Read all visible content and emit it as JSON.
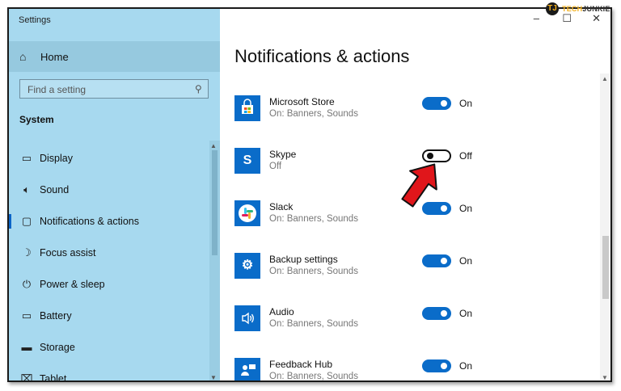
{
  "window": {
    "title": "Settings",
    "minimize": "–",
    "maximize": "☐",
    "close": "✕"
  },
  "sidebar": {
    "home_label": "Home",
    "search_placeholder": "Find a setting",
    "section_title": "System",
    "items": [
      {
        "label": "Display",
        "icon": "monitor-icon"
      },
      {
        "label": "Sound",
        "icon": "speaker-icon"
      },
      {
        "label": "Notifications & actions",
        "icon": "message-icon",
        "active": true
      },
      {
        "label": "Focus assist",
        "icon": "moon-icon"
      },
      {
        "label": "Power & sleep",
        "icon": "power-icon"
      },
      {
        "label": "Battery",
        "icon": "battery-icon"
      },
      {
        "label": "Storage",
        "icon": "drive-icon"
      },
      {
        "label": "Tablet",
        "icon": "tablet-icon"
      }
    ]
  },
  "main": {
    "title": "Notifications & actions",
    "apps": [
      {
        "name": "Microsoft Store",
        "desc": "On: Banners, Sounds",
        "state": "On",
        "on": true,
        "icon": "store-icon"
      },
      {
        "name": "Skype",
        "desc": "Off",
        "state": "Off",
        "on": false,
        "icon": "skype-icon"
      },
      {
        "name": "Slack",
        "desc": "On: Banners, Sounds",
        "state": "On",
        "on": true,
        "icon": "slack-icon"
      },
      {
        "name": "Backup settings",
        "desc": "On: Banners, Sounds",
        "state": "On",
        "on": true,
        "icon": "gear-icon"
      },
      {
        "name": "Audio",
        "desc": "On: Banners, Sounds",
        "state": "On",
        "on": true,
        "icon": "speaker-icon"
      },
      {
        "name": "Feedback Hub",
        "desc": "On: Banners, Sounds",
        "state": "On",
        "on": true,
        "icon": "feedback-icon"
      }
    ]
  },
  "watermark": {
    "part1": "TECH",
    "part2": "JUNKIE",
    "badge": "TJ"
  },
  "colors": {
    "accent": "#0a6cc9",
    "sidebar_bg": "#a7d9ef",
    "arrow": "#e0161b"
  }
}
